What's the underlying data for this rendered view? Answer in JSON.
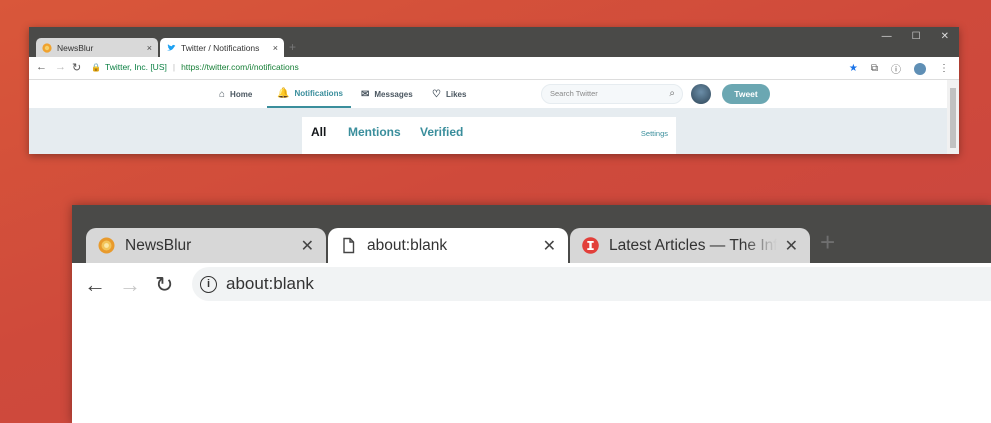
{
  "top_window": {
    "tabs": [
      {
        "title": "NewsBlur",
        "icon": "newsblur-icon",
        "close": "×"
      },
      {
        "title": "Twitter / Notifications",
        "icon": "twitter-bird-icon",
        "close": "×"
      }
    ],
    "new_tab": "+",
    "window_controls": {
      "minimize": "—",
      "maximize": "☐",
      "close": "✕"
    },
    "nav": {
      "back": "←",
      "forward": "→",
      "reload": "↻"
    },
    "omnibox": {
      "org": "Twitter, Inc. [US]",
      "separator": "|",
      "url": "https://twitter.com/i/notifications"
    },
    "toolbar_right": {
      "star": "★",
      "ext": "⧉",
      "info": "ⓘ",
      "menu": "⋮"
    },
    "twitter": {
      "nav": [
        {
          "label": "Home",
          "icon": "home-icon",
          "glyph": "⌂"
        },
        {
          "label": "Notifications",
          "icon": "bell-icon",
          "glyph": "🔔"
        },
        {
          "label": "Messages",
          "icon": "envelope-icon",
          "glyph": "✉"
        },
        {
          "label": "Likes",
          "icon": "heart-icon",
          "glyph": "♡"
        }
      ],
      "search_placeholder": "Search Twitter",
      "search_glyph": "⌕",
      "tweet_button": "Tweet",
      "tabs": [
        "All",
        "Mentions",
        "Verified"
      ],
      "settings": "Settings"
    }
  },
  "bottom_window": {
    "tabs": [
      {
        "title": "NewsBlur",
        "icon": "newsblur-icon",
        "close": "✕"
      },
      {
        "title": "about:blank",
        "icon": "blank-page-icon",
        "close": "✕"
      },
      {
        "title": "Latest Articles — The Info",
        "icon": "the-information-icon",
        "close": "✕"
      }
    ],
    "new_tab": "+",
    "nav": {
      "back": "←",
      "forward": "→",
      "reload": "↻"
    },
    "omnibox": {
      "info_glyph": "i",
      "url": "about:blank"
    }
  },
  "colors": {
    "background": "#cf4a3b",
    "tabstrip": "#4a4a48",
    "twitter_accent": "#3a8e9c",
    "tweet_button": "#6ba7b2",
    "secure_green": "#0b8043"
  }
}
